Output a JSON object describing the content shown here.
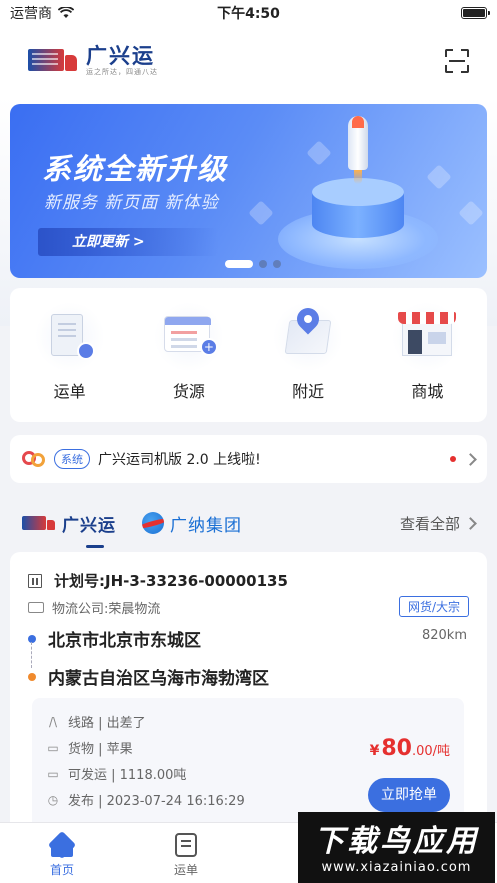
{
  "status_bar": {
    "carrier": "运营商",
    "time": "下午4:50"
  },
  "header": {
    "logo_name": "广兴运",
    "logo_tagline": "运之所达，四通八达",
    "scan_icon": "scan-icon"
  },
  "banner": {
    "title": "系统全新升级",
    "subtitle": "新服务 新页面 新体验",
    "button_label": "立即更新  >",
    "slides": 3,
    "active_slide": 1
  },
  "menu": [
    {
      "label": "运单",
      "icon": "waybill-icon"
    },
    {
      "label": "货源",
      "icon": "goods-source-icon"
    },
    {
      "label": "附近",
      "icon": "nearby-map-icon"
    },
    {
      "label": "商城",
      "icon": "mall-shop-icon"
    }
  ],
  "notice": {
    "tag": "系统",
    "text": "广兴运司机版 2.0 上线啦!"
  },
  "tabs": {
    "items": [
      {
        "label": "广兴运",
        "active": true
      },
      {
        "label": "广纳集团",
        "active": false
      }
    ],
    "view_all": "查看全部"
  },
  "plan": {
    "plan_number": "计划号:JH-3-33236-00000135",
    "company": "物流公司:荣晨物流",
    "type_tag": "网货/大宗",
    "from": "北京市北京市东城区",
    "to": "内蒙古自治区乌海市海勃湾区",
    "distance": "820km",
    "route": "线路 | 出差了",
    "cargo": "货物 | 苹果",
    "available": "可发运 | 1118.00吨",
    "published": "发布 | 2023-07-24 16:16:29",
    "price_currency": "¥",
    "price_value": "80",
    "price_unit": ".00/吨",
    "grab_label": "立即抢单"
  },
  "bottom_nav": [
    {
      "label": "首页",
      "icon": "home-icon",
      "active": true
    },
    {
      "label": "运单",
      "icon": "waybill-doc-icon",
      "active": false
    }
  ],
  "watermark": {
    "main": "下载鸟应用",
    "sub": "www.xiazainiao.com"
  },
  "colors": {
    "primary": "#3b6fe0",
    "brand_navy": "#1b3f8c",
    "price_red": "#e5302f"
  }
}
